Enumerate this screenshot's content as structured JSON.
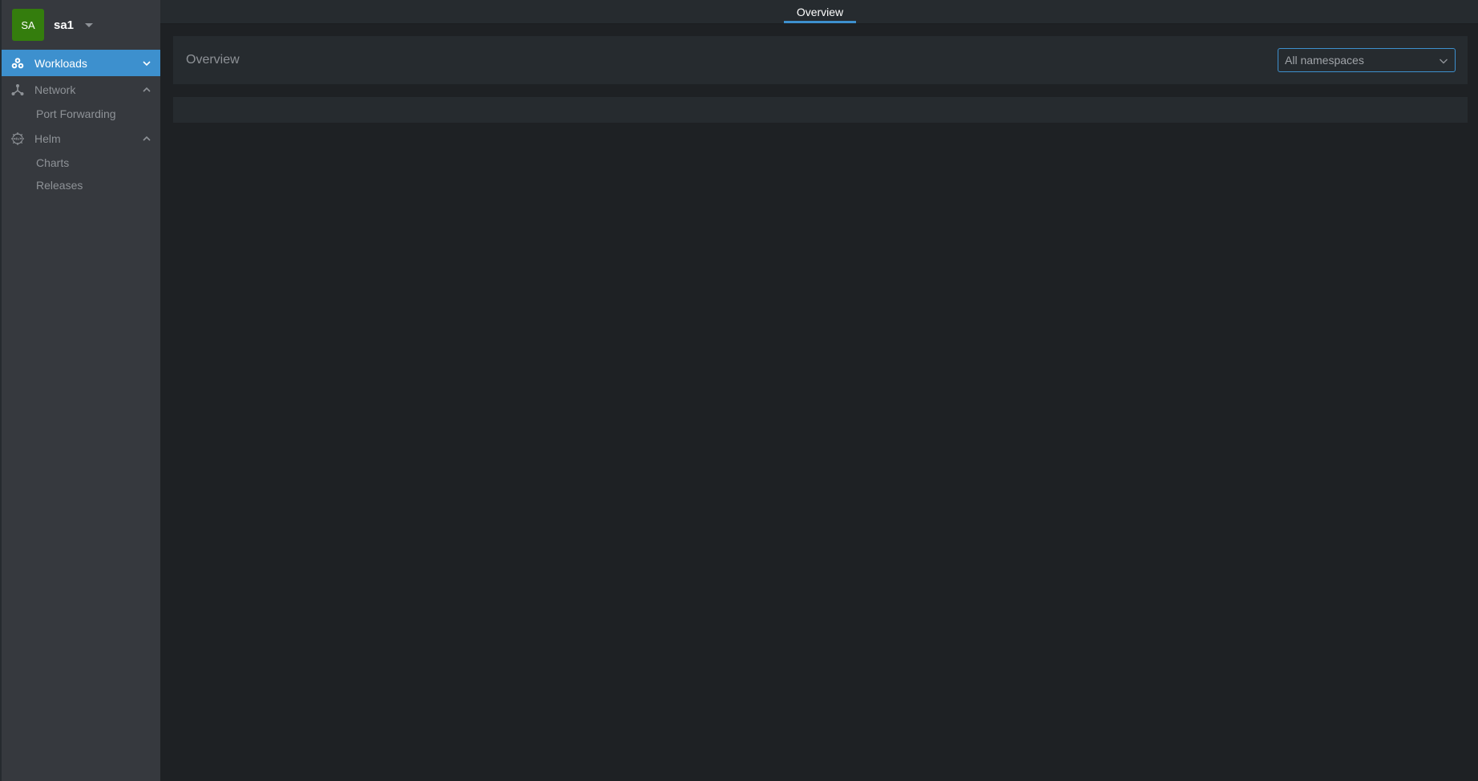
{
  "cluster": {
    "initials": "SA",
    "name": "sa1",
    "avatar_color": "#347d0d"
  },
  "sidebar": {
    "items": [
      {
        "label": "Workloads",
        "icon": "workloads-icon",
        "active": true,
        "expanded": false
      },
      {
        "label": "Network",
        "icon": "network-icon",
        "active": false,
        "expanded": true,
        "children": [
          {
            "label": "Port Forwarding"
          }
        ]
      },
      {
        "label": "Helm",
        "icon": "helm-icon",
        "active": false,
        "expanded": true,
        "children": [
          {
            "label": "Charts"
          },
          {
            "label": "Releases"
          }
        ]
      }
    ]
  },
  "topbar": {
    "tabs": [
      {
        "label": "Overview",
        "active": true
      }
    ]
  },
  "main": {
    "title": "Overview",
    "namespace_select": {
      "value": "All namespaces"
    }
  },
  "colors": {
    "accent": "#3d90ce",
    "sidebar_bg": "#36393e",
    "main_bg": "#1e2124",
    "panel_bg": "#262b2f"
  }
}
